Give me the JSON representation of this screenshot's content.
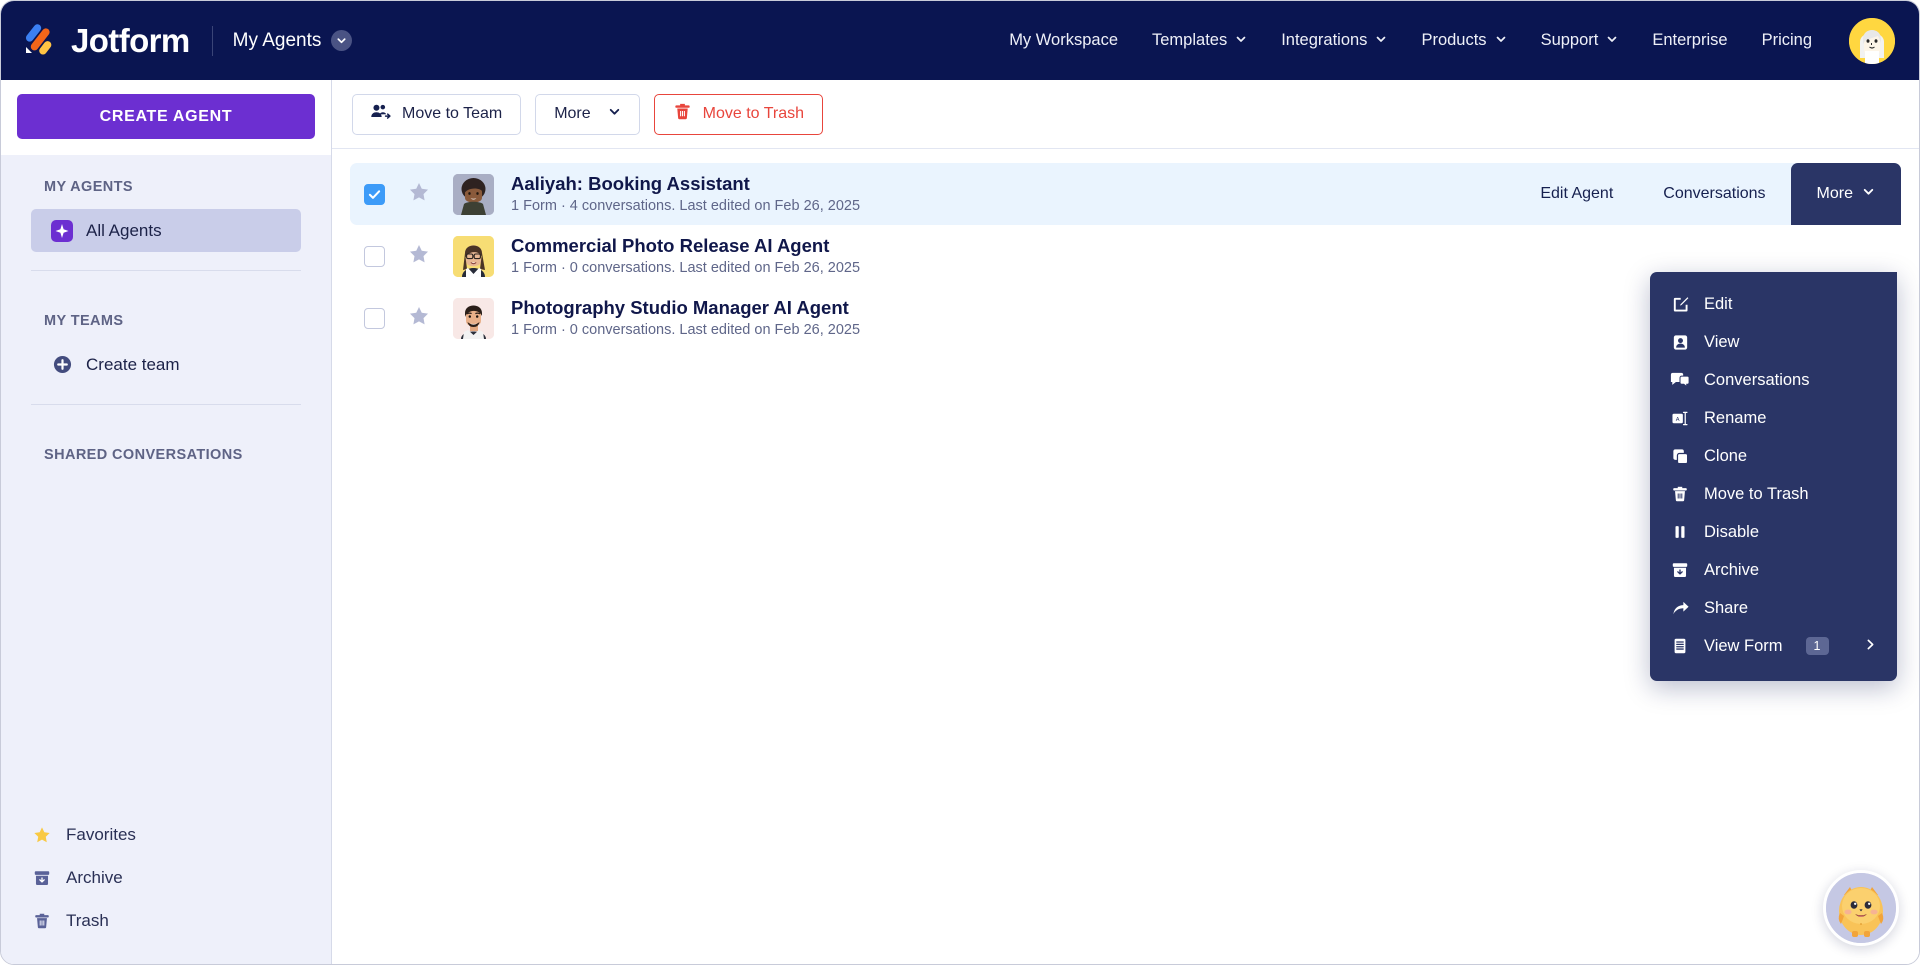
{
  "header": {
    "brand": "Jotform",
    "logo_icon": "jotform-logo-icon",
    "workspace_label": "My Agents",
    "workspace_caret_icon": "chevron-down-icon",
    "nav": [
      {
        "label": "My Workspace",
        "has_caret": false
      },
      {
        "label": "Templates",
        "has_caret": true
      },
      {
        "label": "Integrations",
        "has_caret": true
      },
      {
        "label": "Products",
        "has_caret": true
      },
      {
        "label": "Support",
        "has_caret": true
      },
      {
        "label": "Enterprise",
        "has_caret": false
      },
      {
        "label": "Pricing",
        "has_caret": false
      }
    ],
    "avatar_icon": "user-avatar"
  },
  "sidebar": {
    "create_button": "CREATE AGENT",
    "section_my_agents": "MY AGENTS",
    "item_all_agents": "All Agents",
    "all_agents_icon": "sparkle-icon",
    "section_my_teams": "MY TEAMS",
    "item_create_team": "Create team",
    "create_team_icon": "plus-circle-icon",
    "section_shared_conversations": "SHARED CONVERSATIONS",
    "bottom": [
      {
        "label": "Favorites",
        "icon": "star-icon"
      },
      {
        "label": "Archive",
        "icon": "archive-icon"
      },
      {
        "label": "Trash",
        "icon": "trash-icon"
      }
    ]
  },
  "toolbar": {
    "move_to_team": "Move to Team",
    "move_to_team_icon": "users-move-icon",
    "more": "More",
    "more_caret_icon": "chevron-down-icon",
    "move_to_trash": "Move to Trash",
    "move_to_trash_icon": "trash-icon"
  },
  "agents": [
    {
      "name": "Aaliyah: Booking Assistant",
      "meta": "1 Form · 4 conversations. Last edited on Feb 26, 2025",
      "selected": true,
      "avatar_bg": "#a9aec4"
    },
    {
      "name": "Commercial Photo Release AI Agent",
      "meta": "1 Form · 0 conversations. Last edited on Feb 26, 2025",
      "selected": false,
      "avatar_bg": "#f7dd74"
    },
    {
      "name": "Photography Studio Manager AI Agent",
      "meta": "1 Form · 0 conversations. Last edited on Feb 26, 2025",
      "selected": false,
      "avatar_bg": "#f8e8e6"
    }
  ],
  "row_actions": {
    "edit_agent": "Edit Agent",
    "conversations": "Conversations",
    "more": "More",
    "more_caret_icon": "chevron-down-icon"
  },
  "more_menu": {
    "items": [
      {
        "label": "Edit",
        "icon": "edit-square-icon"
      },
      {
        "label": "View",
        "icon": "person-card-icon"
      },
      {
        "label": "Conversations",
        "icon": "chat-bubbles-icon"
      },
      {
        "label": "Rename",
        "icon": "rename-icon"
      },
      {
        "label": "Clone",
        "icon": "copy-icon"
      },
      {
        "label": "Move to Trash",
        "icon": "trash-icon"
      },
      {
        "label": "Disable",
        "icon": "pause-icon"
      },
      {
        "label": "Archive",
        "icon": "archive-icon"
      },
      {
        "label": "Share",
        "icon": "share-arrow-icon"
      },
      {
        "label": "View Form",
        "icon": "form-list-icon",
        "badge": "1",
        "submenu_icon": "chevron-right-icon"
      }
    ]
  },
  "chat_widget": {
    "icon": "jotform-mascot-icon"
  },
  "colors": {
    "header_bg": "#0a1551",
    "brand_purple": "#6c2fd1",
    "danger_red": "#e8453c",
    "menu_bg": "#2a3566",
    "row_selected_bg": "#eaf4fe",
    "checkbox_blue": "#3d9bf8",
    "star_gray": "#b4b9d4",
    "favorite_yellow": "#f9c943"
  }
}
